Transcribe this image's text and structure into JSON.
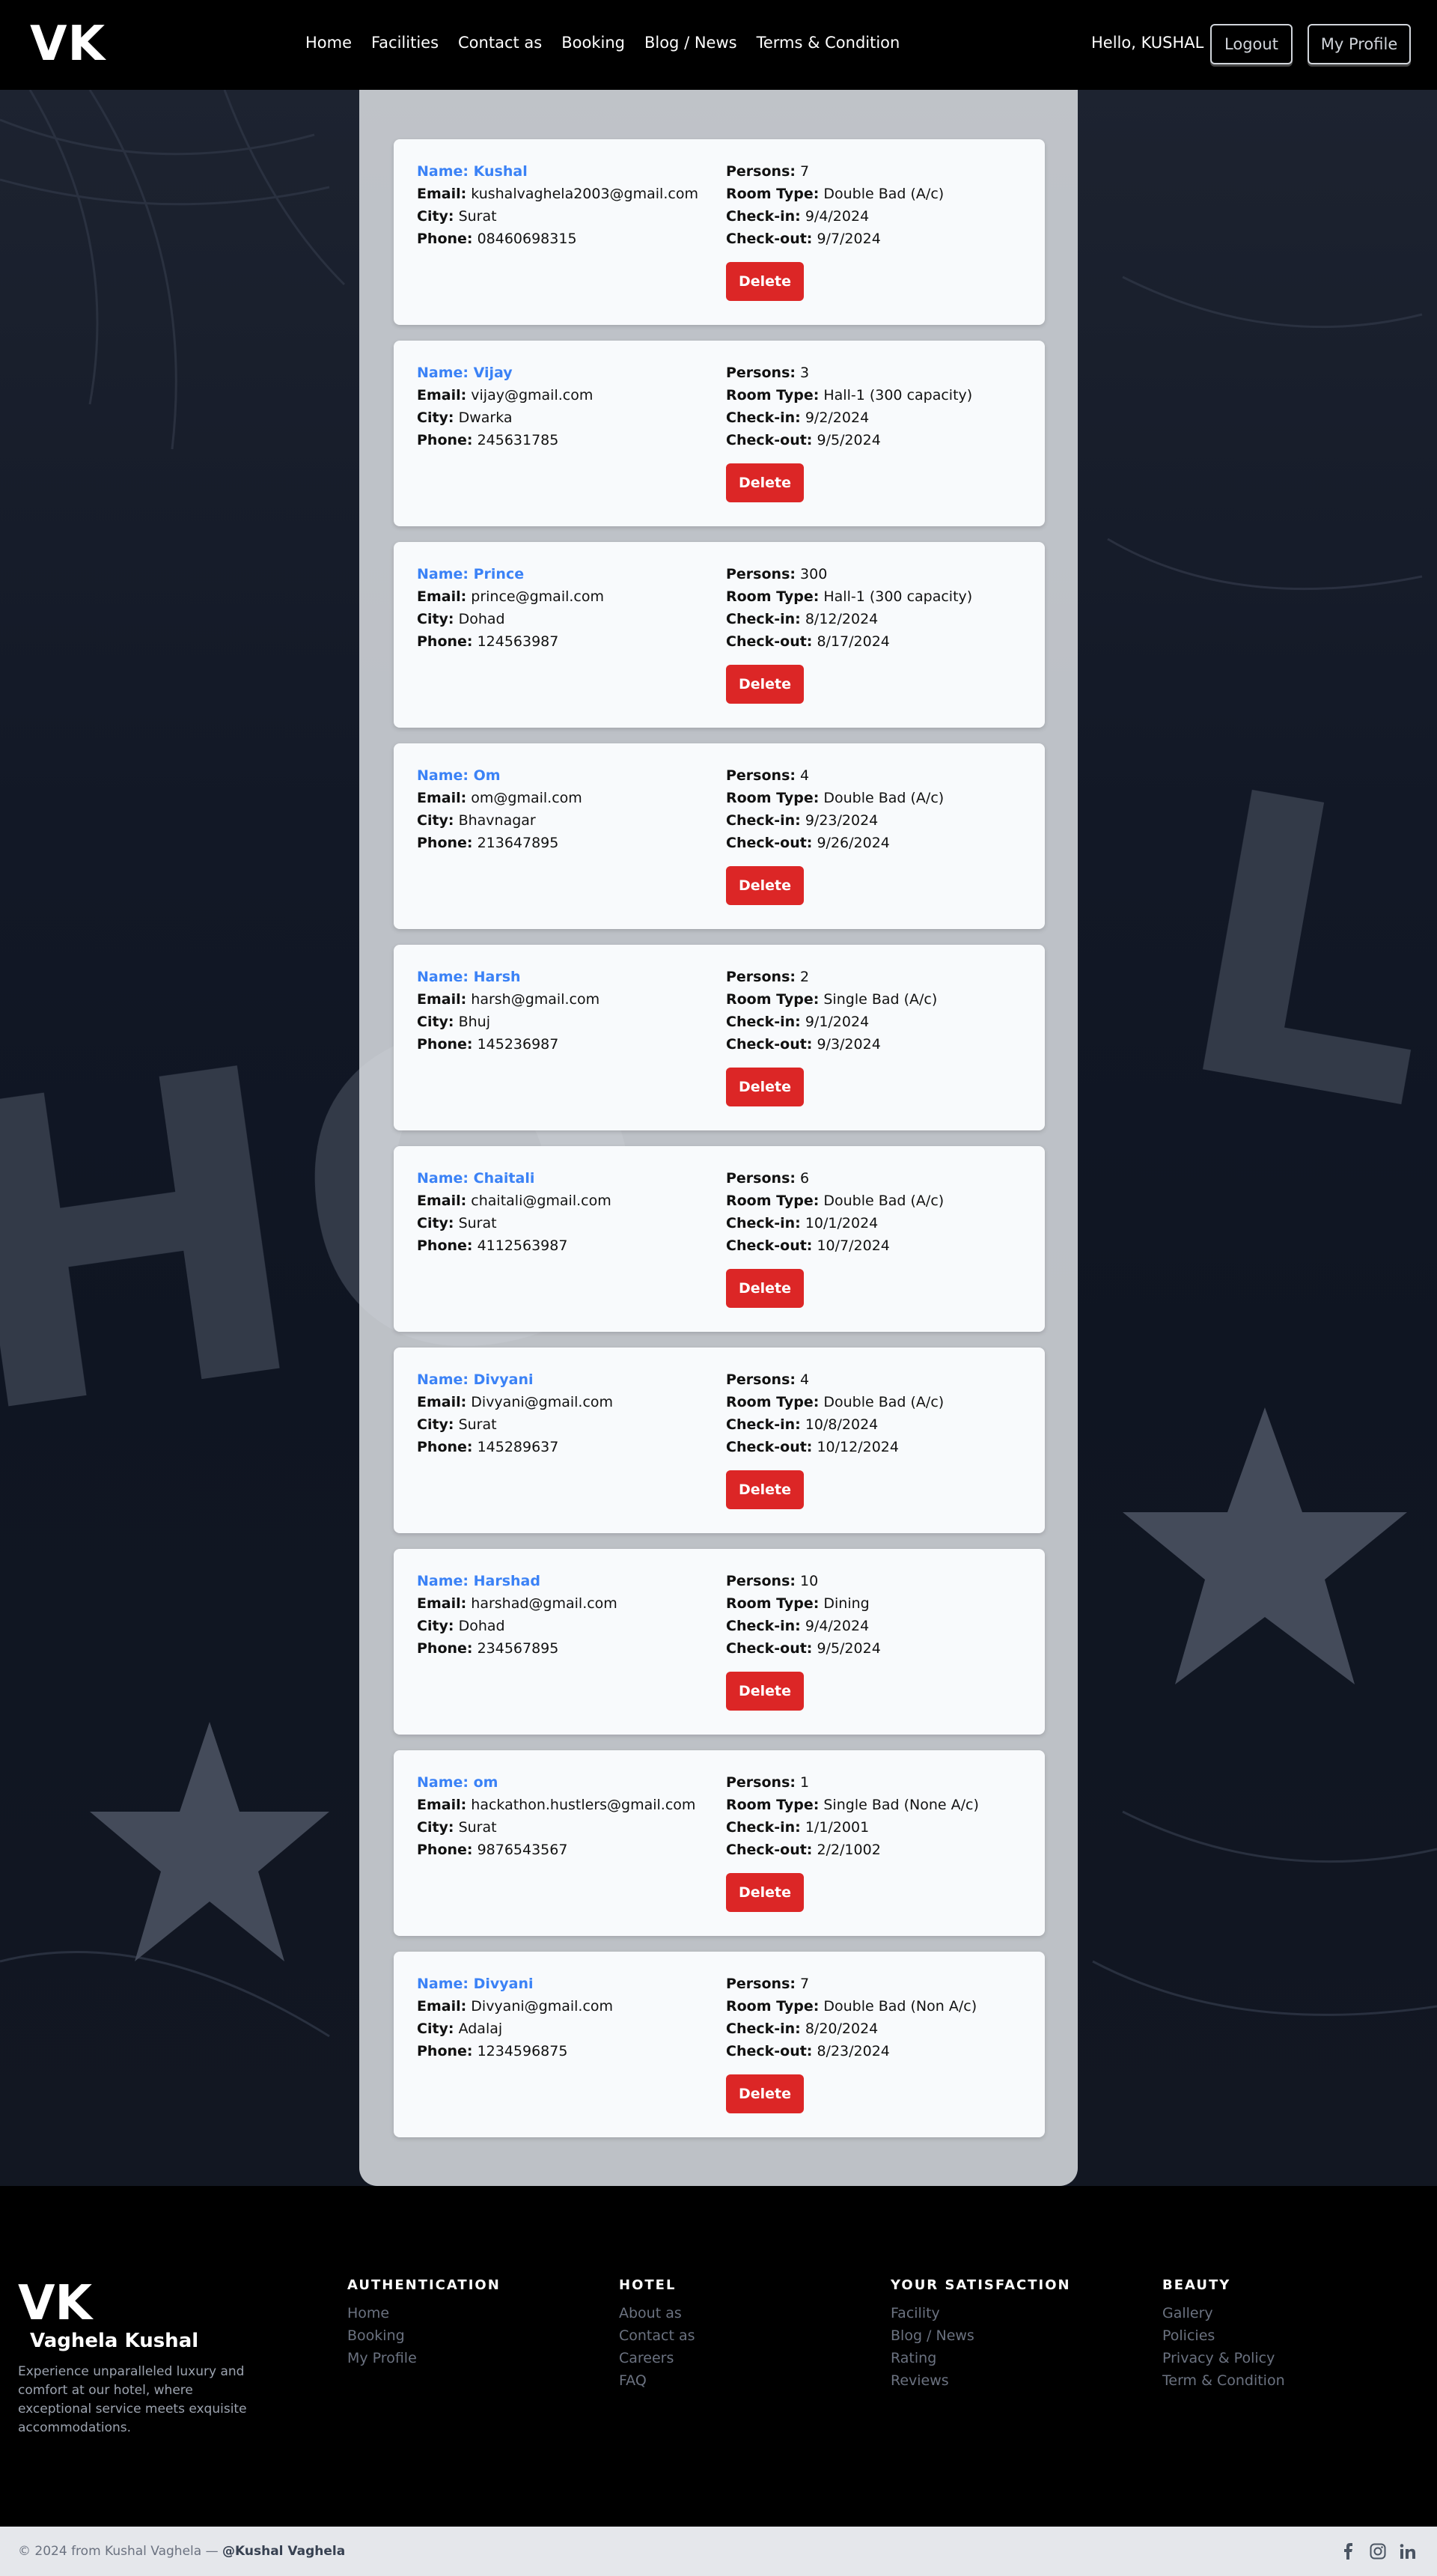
{
  "header": {
    "logo": "VK",
    "nav": [
      "Home",
      "Facilities",
      "Contact as",
      "Booking",
      "Blog / News",
      "Terms & Condition"
    ],
    "greeting": "Hello, KUSHAL",
    "logout_label": "Logout",
    "profile_label": "My Profile"
  },
  "labels": {
    "email": "Email:",
    "city": "City:",
    "phone": "Phone:",
    "persons": "Persons:",
    "room_type": "Room Type:",
    "check_in": "Check-in:",
    "check_out": "Check-out:",
    "delete": "Delete"
  },
  "bookings": [
    {
      "name": "Name: Kushal",
      "email": "kushalvaghela2003@gmail.com",
      "city": "Surat",
      "phone": "08460698315",
      "persons": "7",
      "room_type": "Double Bad (A/c)",
      "check_in": "9/4/2024",
      "check_out": "9/7/2024"
    },
    {
      "name": "Name: Vijay",
      "email": "vijay@gmail.com",
      "city": "Dwarka",
      "phone": "245631785",
      "persons": "3",
      "room_type": "Hall-1 (300 capacity)",
      "check_in": "9/2/2024",
      "check_out": "9/5/2024"
    },
    {
      "name": "Name: Prince",
      "email": "prince@gmail.com",
      "city": "Dohad",
      "phone": "124563987",
      "persons": "300",
      "room_type": "Hall-1 (300 capacity)",
      "check_in": "8/12/2024",
      "check_out": "8/17/2024"
    },
    {
      "name": "Name: Om",
      "email": "om@gmail.com",
      "city": "Bhavnagar",
      "phone": "213647895",
      "persons": "4",
      "room_type": "Double Bad (A/c)",
      "check_in": "9/23/2024",
      "check_out": "9/26/2024"
    },
    {
      "name": "Name: Harsh",
      "email": "harsh@gmail.com",
      "city": "Bhuj",
      "phone": "145236987",
      "persons": "2",
      "room_type": "Single Bad (A/c)",
      "check_in": "9/1/2024",
      "check_out": "9/3/2024"
    },
    {
      "name": "Name: Chaitali",
      "email": "chaitali@gmail.com",
      "city": "Surat",
      "phone": "4112563987",
      "persons": "6",
      "room_type": "Double Bad (A/c)",
      "check_in": "10/1/2024",
      "check_out": "10/7/2024"
    },
    {
      "name": "Name: Divyani",
      "email": "Divyani@gmail.com",
      "city": "Surat",
      "phone": "145289637",
      "persons": "4",
      "room_type": "Double Bad (A/c)",
      "check_in": "10/8/2024",
      "check_out": "10/12/2024"
    },
    {
      "name": "Name: Harshad",
      "email": "harshad@gmail.com",
      "city": "Dohad",
      "phone": "234567895",
      "persons": "10",
      "room_type": "Dining",
      "check_in": "9/4/2024",
      "check_out": "9/5/2024"
    },
    {
      "name": "Name: om",
      "email": "hackathon.hustlers@gmail.com",
      "city": "Surat",
      "phone": "9876543567",
      "persons": "1",
      "room_type": "Single Bad (None A/c)",
      "check_in": "1/1/2001",
      "check_out": "2/2/1002"
    },
    {
      "name": "Name: Divyani",
      "email": "Divyani@gmail.com",
      "city": "Adalaj",
      "phone": "1234596875",
      "persons": "7",
      "room_type": "Double Bad (Non A/c)",
      "check_in": "8/20/2024",
      "check_out": "8/23/2024"
    }
  ],
  "footer": {
    "logo": "VK",
    "brand": "Vaghela Kushal",
    "description": "Experience unparalleled luxury and comfort at our hotel, where exceptional service meets exquisite accommodations.",
    "columns": [
      {
        "title": "AUTHENTICATION",
        "links": [
          "Home",
          "Booking",
          "My Profile"
        ]
      },
      {
        "title": "HOTEL",
        "links": [
          "About as",
          "Contact as",
          "Careers",
          "FAQ"
        ]
      },
      {
        "title": "YOUR SATISFACTION",
        "links": [
          "Facility",
          "Blog / News",
          "Rating",
          "Reviews"
        ]
      },
      {
        "title": "BEAUTY",
        "links": [
          "Gallery",
          "Policies",
          "Privacy & Policy",
          "Term & Condition"
        ]
      }
    ],
    "copyright": "© 2024 from Kushal Vaghela —",
    "handle": "@Kushal Vaghela",
    "social_icons": [
      "facebook-icon",
      "instagram-icon",
      "linkedin-icon"
    ]
  }
}
